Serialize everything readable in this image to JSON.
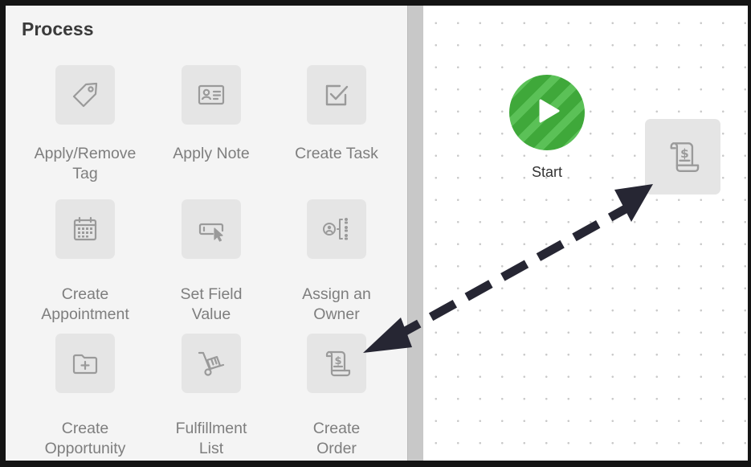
{
  "palette": {
    "title": "Process",
    "items": [
      {
        "label": "Apply/Remove\nTag",
        "icon": "tag-icon"
      },
      {
        "label": "Apply Note",
        "icon": "contact-card-icon"
      },
      {
        "label": "Create Task",
        "icon": "checkbox-icon"
      },
      {
        "label": "Create\nAppointment",
        "icon": "calendar-icon"
      },
      {
        "label": "Set Field\nValue",
        "icon": "field-cursor-icon"
      },
      {
        "label": "Assign an\nOwner",
        "icon": "assign-owner-icon"
      },
      {
        "label": "Create\nOpportunity",
        "icon": "folder-plus-icon"
      },
      {
        "label": "Fulfillment\nList",
        "icon": "hand-truck-icon"
      },
      {
        "label": "Create\nOrder",
        "icon": "receipt-dollar-icon"
      }
    ]
  },
  "canvas": {
    "start_node": {
      "label": "Start",
      "icon": "play-icon"
    },
    "placed_node": {
      "icon": "receipt-dollar-icon"
    }
  },
  "colors": {
    "start_green": "#3fa83a",
    "icon_gray": "#9a9a9a",
    "arrow": "#262633"
  }
}
